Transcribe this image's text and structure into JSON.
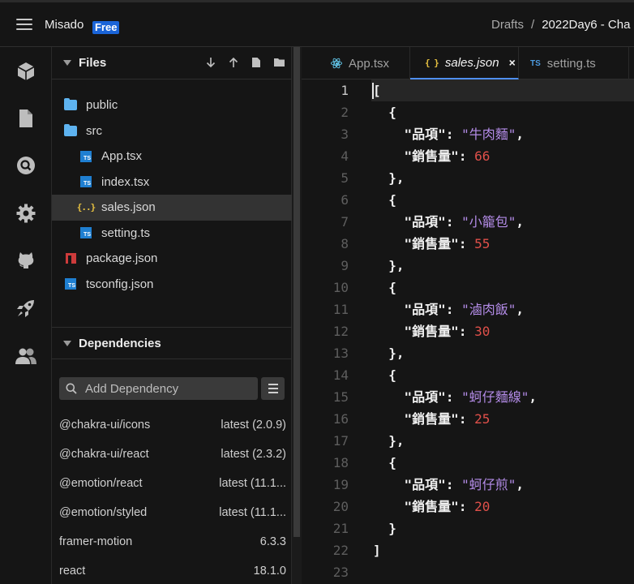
{
  "header": {
    "app_name": "Misado",
    "plan_badge": "Free",
    "breadcrumb": {
      "parent": "Drafts",
      "separator": "/",
      "current": "2022Day6 - Cha"
    }
  },
  "activity_bar": [
    {
      "name": "cube-icon",
      "label": "Sandbox"
    },
    {
      "name": "file-icon",
      "label": "Files"
    },
    {
      "name": "search-icon",
      "label": "Search"
    },
    {
      "name": "gear-icon",
      "label": "Settings"
    },
    {
      "name": "github-icon",
      "label": "GitHub"
    },
    {
      "name": "rocket-icon",
      "label": "Deploy"
    },
    {
      "name": "users-icon",
      "label": "Live"
    }
  ],
  "files": {
    "title": "Files",
    "tree": [
      {
        "label": "public",
        "type": "folder",
        "depth": 0
      },
      {
        "label": "src",
        "type": "folder-open",
        "depth": 0
      },
      {
        "label": "App.tsx",
        "type": "ts",
        "depth": 1
      },
      {
        "label": "index.tsx",
        "type": "ts",
        "depth": 1
      },
      {
        "label": "sales.json",
        "type": "json",
        "depth": 1,
        "selected": true
      },
      {
        "label": "setting.ts",
        "type": "ts",
        "depth": 1
      },
      {
        "label": "package.json",
        "type": "npm",
        "depth": 0
      },
      {
        "label": "tsconfig.json",
        "type": "ts",
        "depth": 0
      }
    ]
  },
  "dependencies": {
    "title": "Dependencies",
    "search_placeholder": "Add Dependency",
    "items": [
      {
        "name": "@chakra-ui/icons",
        "version": "latest (2.0.9)"
      },
      {
        "name": "@chakra-ui/react",
        "version": "latest (2.3.2)"
      },
      {
        "name": "@emotion/react",
        "version": "latest (11.1..."
      },
      {
        "name": "@emotion/styled",
        "version": "latest (11.1..."
      },
      {
        "name": "framer-motion",
        "version": "6.3.3"
      },
      {
        "name": "react",
        "version": "18.1.0"
      }
    ]
  },
  "tabs": [
    {
      "label": "App.tsx",
      "icon": "react-icon"
    },
    {
      "label": "sales.json",
      "icon": "json-icon",
      "active": true,
      "close": "×"
    },
    {
      "label": "setting.ts",
      "icon": "ts-icon"
    }
  ],
  "editor": {
    "current_line": 1,
    "lines": [
      "[",
      "  {",
      "    \"品項\": \"牛肉麵\",",
      "    \"銷售量\": 66",
      "  },",
      "  {",
      "    \"品項\": \"小籠包\",",
      "    \"銷售量\": 55",
      "  },",
      "  {",
      "    \"品項\": \"滷肉飯\",",
      "    \"銷售量\": 30",
      "  },",
      "  {",
      "    \"品項\": \"蚵仔麵線\",",
      "    \"銷售量\": 25",
      "  },",
      "  {",
      "    \"品項\": \"蚵仔煎\",",
      "    \"銷售量\": 20",
      "  }",
      "]",
      ""
    ]
  }
}
